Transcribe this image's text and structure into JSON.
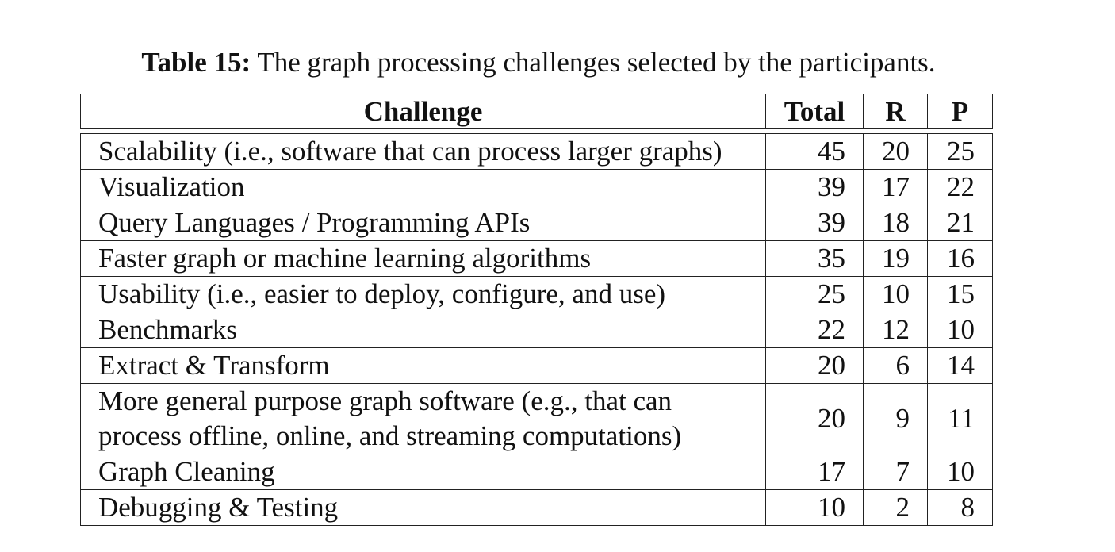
{
  "caption": {
    "label": "Table 15:",
    "text": "The graph processing challenges selected by the participants."
  },
  "table": {
    "headers": {
      "challenge": "Challenge",
      "total": "Total",
      "r": "R",
      "p": "P"
    },
    "rows": [
      {
        "challenge": "Scalability (i.e., software that can process larger graphs)",
        "total": "45",
        "r": "20",
        "p": "25"
      },
      {
        "challenge": "Visualization",
        "total": "39",
        "r": "17",
        "p": "22"
      },
      {
        "challenge": "Query Languages / Programming APIs",
        "total": "39",
        "r": "18",
        "p": "21"
      },
      {
        "challenge": "Faster graph or machine learning algorithms",
        "total": "35",
        "r": "19",
        "p": "16"
      },
      {
        "challenge": "Usability (i.e., easier to deploy, configure, and use)",
        "total": "25",
        "r": "10",
        "p": "15"
      },
      {
        "challenge": "Benchmarks",
        "total": "22",
        "r": "12",
        "p": "10"
      },
      {
        "challenge": "Extract & Transform",
        "total": "20",
        "r": "6",
        "p": "14"
      },
      {
        "challenge_line1": "More general purpose graph software (e.g., that can",
        "challenge_line2": "process offline, online, and streaming computations)",
        "total": "20",
        "r": "9",
        "p": "11"
      },
      {
        "challenge": "Graph Cleaning",
        "total": "17",
        "r": "7",
        "p": "10"
      },
      {
        "challenge": "Debugging & Testing",
        "total": "10",
        "r": "2",
        "p": "8"
      }
    ]
  }
}
